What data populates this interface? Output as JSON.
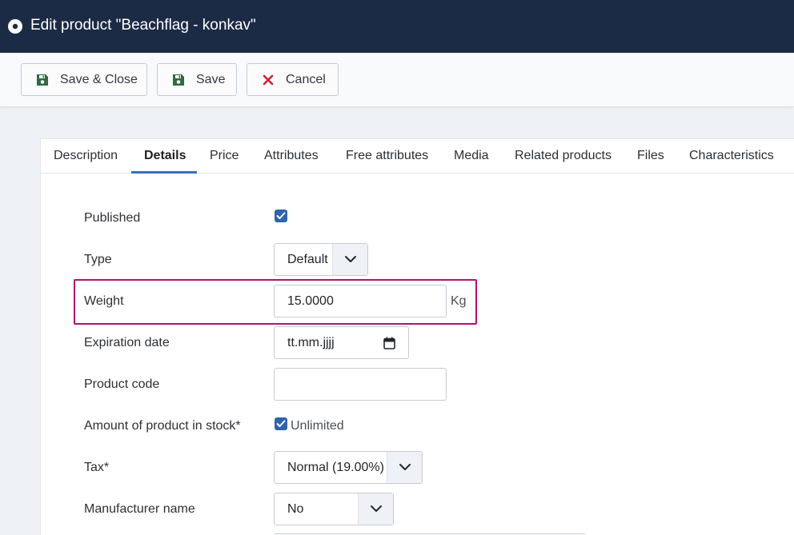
{
  "titlebar": {
    "title": "Edit product \"Beachflag - konkav\"",
    "icon": "disc-icon"
  },
  "toolbar": {
    "save_close": "Save & Close",
    "save": "Save",
    "cancel": "Cancel",
    "save_icon": "floppy-disk-icon",
    "cancel_icon": "x-icon",
    "colors": {
      "save_icon": "#2f6b3f",
      "cancel_icon": "#c9252d"
    }
  },
  "tabs": [
    "Description",
    "Details",
    "Price",
    "Attributes",
    "Free attributes",
    "Media",
    "Related products",
    "Files",
    "Characteristics"
  ],
  "active_tab": "Details",
  "form": {
    "published": {
      "label": "Published",
      "checked": true
    },
    "type": {
      "label": "Type",
      "value": "Default"
    },
    "weight": {
      "label": "Weight",
      "value": "15.0000",
      "unit": "Kg"
    },
    "expiration": {
      "label": "Expiration date",
      "placeholder": "tt.mm.jjjj"
    },
    "product_code": {
      "label": "Product code",
      "value": ""
    },
    "stock": {
      "label": "Amount of product in stock*",
      "checkbox_label": "Unlimited",
      "checked": true
    },
    "tax": {
      "label": "Tax*",
      "value": "Normal (19.00%)"
    },
    "manufacturer": {
      "label": "Manufacturer name",
      "value": "No"
    }
  },
  "colors": {
    "header_bg": "#1c2b45",
    "accent": "#2e63b0",
    "highlight": "#b3126c"
  }
}
